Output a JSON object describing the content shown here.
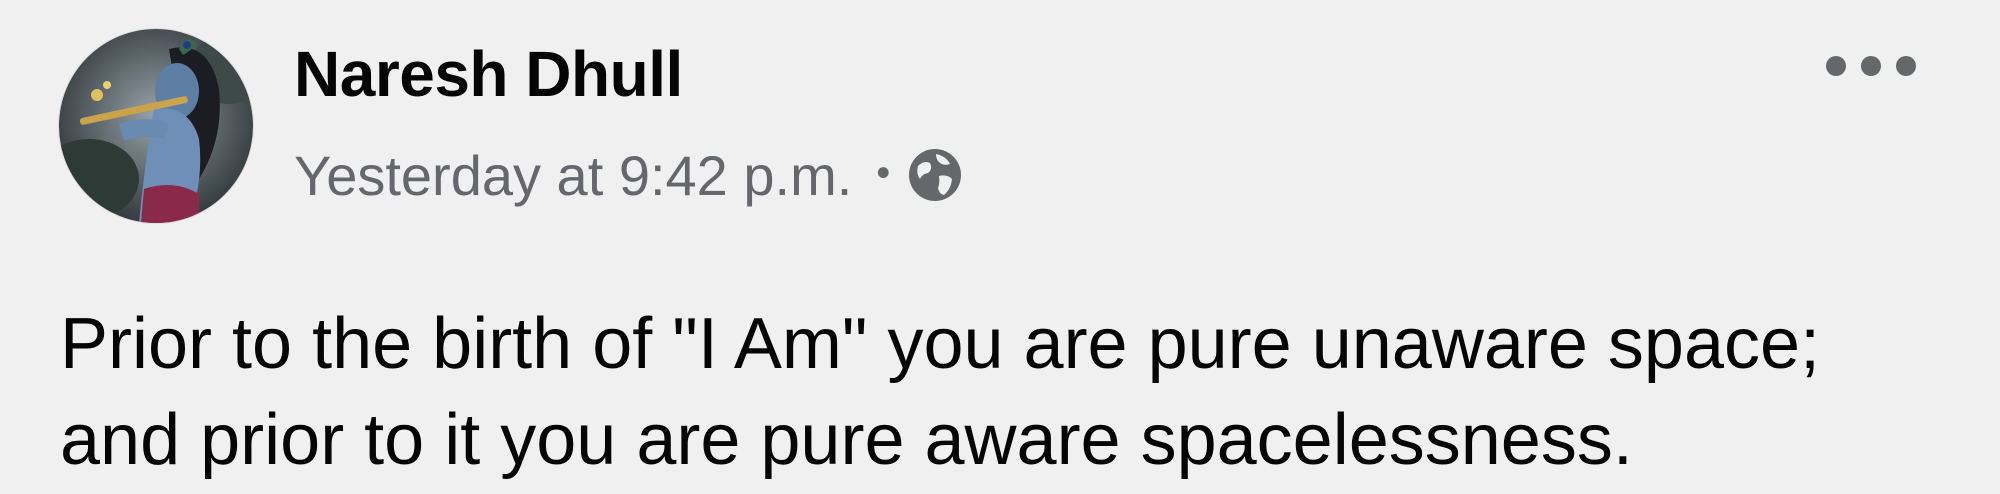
{
  "post": {
    "author_name": "Naresh Dhull",
    "timestamp": "Yesterday at 9:42 p.m.",
    "separator": "•",
    "audience_icon": "globe-icon",
    "menu_icon": "more-options-icon",
    "text_lines": [
      "Prior to the birth of \"I Am\" you are pure unaware space;",
      "and prior to it you are pure aware spacelessness."
    ]
  },
  "colors": {
    "primary_text": "#050505",
    "secondary_text": "#65676b",
    "background": "#f0f0f0"
  }
}
